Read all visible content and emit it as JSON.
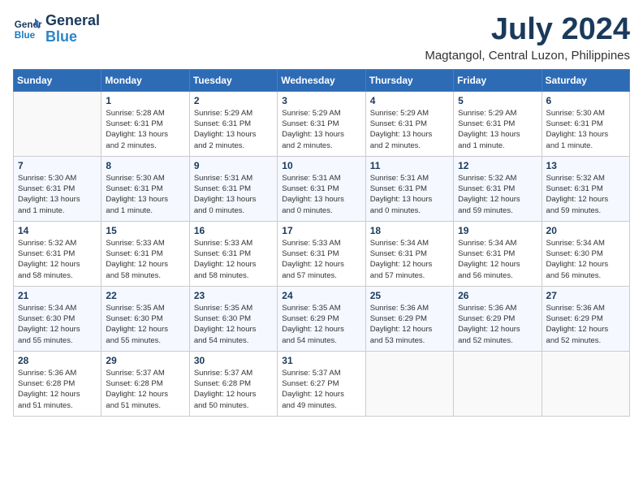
{
  "header": {
    "logo_line1": "General",
    "logo_line2": "Blue",
    "month": "July 2024",
    "location": "Magtangol, Central Luzon, Philippines"
  },
  "weekdays": [
    "Sunday",
    "Monday",
    "Tuesday",
    "Wednesday",
    "Thursday",
    "Friday",
    "Saturday"
  ],
  "weeks": [
    [
      {
        "day": "",
        "info": ""
      },
      {
        "day": "1",
        "info": "Sunrise: 5:28 AM\nSunset: 6:31 PM\nDaylight: 13 hours\nand 2 minutes."
      },
      {
        "day": "2",
        "info": "Sunrise: 5:29 AM\nSunset: 6:31 PM\nDaylight: 13 hours\nand 2 minutes."
      },
      {
        "day": "3",
        "info": "Sunrise: 5:29 AM\nSunset: 6:31 PM\nDaylight: 13 hours\nand 2 minutes."
      },
      {
        "day": "4",
        "info": "Sunrise: 5:29 AM\nSunset: 6:31 PM\nDaylight: 13 hours\nand 2 minutes."
      },
      {
        "day": "5",
        "info": "Sunrise: 5:29 AM\nSunset: 6:31 PM\nDaylight: 13 hours\nand 1 minute."
      },
      {
        "day": "6",
        "info": "Sunrise: 5:30 AM\nSunset: 6:31 PM\nDaylight: 13 hours\nand 1 minute."
      }
    ],
    [
      {
        "day": "7",
        "info": "Sunrise: 5:30 AM\nSunset: 6:31 PM\nDaylight: 13 hours\nand 1 minute."
      },
      {
        "day": "8",
        "info": "Sunrise: 5:30 AM\nSunset: 6:31 PM\nDaylight: 13 hours\nand 1 minute."
      },
      {
        "day": "9",
        "info": "Sunrise: 5:31 AM\nSunset: 6:31 PM\nDaylight: 13 hours\nand 0 minutes."
      },
      {
        "day": "10",
        "info": "Sunrise: 5:31 AM\nSunset: 6:31 PM\nDaylight: 13 hours\nand 0 minutes."
      },
      {
        "day": "11",
        "info": "Sunrise: 5:31 AM\nSunset: 6:31 PM\nDaylight: 13 hours\nand 0 minutes."
      },
      {
        "day": "12",
        "info": "Sunrise: 5:32 AM\nSunset: 6:31 PM\nDaylight: 12 hours\nand 59 minutes."
      },
      {
        "day": "13",
        "info": "Sunrise: 5:32 AM\nSunset: 6:31 PM\nDaylight: 12 hours\nand 59 minutes."
      }
    ],
    [
      {
        "day": "14",
        "info": "Sunrise: 5:32 AM\nSunset: 6:31 PM\nDaylight: 12 hours\nand 58 minutes."
      },
      {
        "day": "15",
        "info": "Sunrise: 5:33 AM\nSunset: 6:31 PM\nDaylight: 12 hours\nand 58 minutes."
      },
      {
        "day": "16",
        "info": "Sunrise: 5:33 AM\nSunset: 6:31 PM\nDaylight: 12 hours\nand 58 minutes."
      },
      {
        "day": "17",
        "info": "Sunrise: 5:33 AM\nSunset: 6:31 PM\nDaylight: 12 hours\nand 57 minutes."
      },
      {
        "day": "18",
        "info": "Sunrise: 5:34 AM\nSunset: 6:31 PM\nDaylight: 12 hours\nand 57 minutes."
      },
      {
        "day": "19",
        "info": "Sunrise: 5:34 AM\nSunset: 6:31 PM\nDaylight: 12 hours\nand 56 minutes."
      },
      {
        "day": "20",
        "info": "Sunrise: 5:34 AM\nSunset: 6:30 PM\nDaylight: 12 hours\nand 56 minutes."
      }
    ],
    [
      {
        "day": "21",
        "info": "Sunrise: 5:34 AM\nSunset: 6:30 PM\nDaylight: 12 hours\nand 55 minutes."
      },
      {
        "day": "22",
        "info": "Sunrise: 5:35 AM\nSunset: 6:30 PM\nDaylight: 12 hours\nand 55 minutes."
      },
      {
        "day": "23",
        "info": "Sunrise: 5:35 AM\nSunset: 6:30 PM\nDaylight: 12 hours\nand 54 minutes."
      },
      {
        "day": "24",
        "info": "Sunrise: 5:35 AM\nSunset: 6:29 PM\nDaylight: 12 hours\nand 54 minutes."
      },
      {
        "day": "25",
        "info": "Sunrise: 5:36 AM\nSunset: 6:29 PM\nDaylight: 12 hours\nand 53 minutes."
      },
      {
        "day": "26",
        "info": "Sunrise: 5:36 AM\nSunset: 6:29 PM\nDaylight: 12 hours\nand 52 minutes."
      },
      {
        "day": "27",
        "info": "Sunrise: 5:36 AM\nSunset: 6:29 PM\nDaylight: 12 hours\nand 52 minutes."
      }
    ],
    [
      {
        "day": "28",
        "info": "Sunrise: 5:36 AM\nSunset: 6:28 PM\nDaylight: 12 hours\nand 51 minutes."
      },
      {
        "day": "29",
        "info": "Sunrise: 5:37 AM\nSunset: 6:28 PM\nDaylight: 12 hours\nand 51 minutes."
      },
      {
        "day": "30",
        "info": "Sunrise: 5:37 AM\nSunset: 6:28 PM\nDaylight: 12 hours\nand 50 minutes."
      },
      {
        "day": "31",
        "info": "Sunrise: 5:37 AM\nSunset: 6:27 PM\nDaylight: 12 hours\nand 49 minutes."
      },
      {
        "day": "",
        "info": ""
      },
      {
        "day": "",
        "info": ""
      },
      {
        "day": "",
        "info": ""
      }
    ]
  ]
}
